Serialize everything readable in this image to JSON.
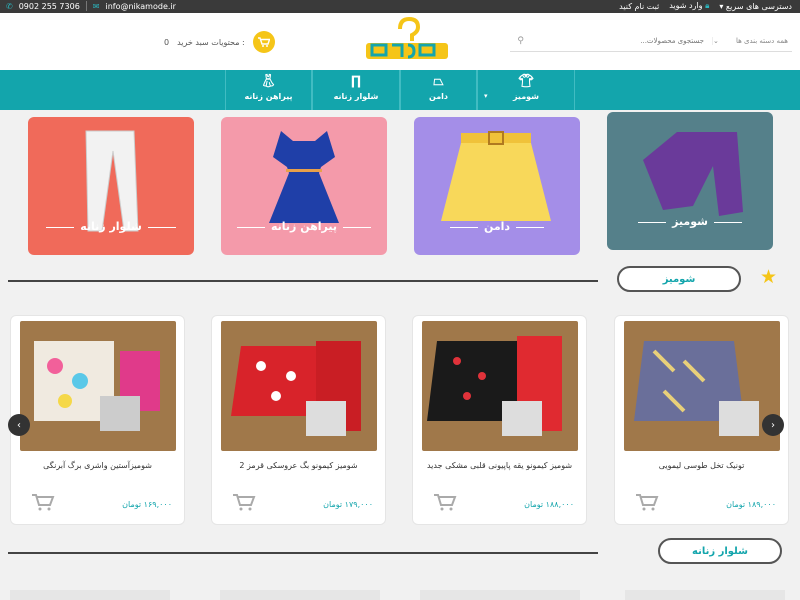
{
  "topbar": {
    "phone": "0902 255 7306",
    "email": "info@nikamode.ir",
    "quick_access": "دسترسی های سریع",
    "login": "وارد شوید",
    "register": "ثبت نام کنید"
  },
  "header": {
    "cart_label": "محتویات سبد خرید :",
    "cart_count": "0",
    "search_placeholder": "جستجوی محصولات...",
    "category_select": "همه دسته بندی ها"
  },
  "nav": [
    {
      "label": "شومیز"
    },
    {
      "label": "دامن"
    },
    {
      "label": "شلوار زنانه"
    },
    {
      "label": "پیراهن زنانه"
    }
  ],
  "category_cards": [
    {
      "label": "شلوار زنانه",
      "bg": "#f06a5a"
    },
    {
      "label": "پیراهن زنانه",
      "bg": "#f49aaa"
    },
    {
      "label": "دامن",
      "bg": "#a48ee8"
    },
    {
      "label": "شومیز",
      "bg": "#55808a"
    }
  ],
  "section1": {
    "title": "شومیز"
  },
  "products": [
    {
      "name": "شومیزآستین واشری برگ آبرنگی",
      "price": "۱۶۹,۰۰۰ تومان"
    },
    {
      "name": "شومیز کیمونو بگ عروسکی قرمز 2",
      "price": "۱۷۹,۰۰۰ تومان"
    },
    {
      "name": "شومیز کیمونو یقه پاپیونی قلبی مشکی جدید",
      "price": "۱۸۸,۰۰۰ تومان"
    },
    {
      "name": "تونیک تخل طوسی لیمویی",
      "price": "۱۸۹,۰۰۰ تومان"
    }
  ],
  "section2": {
    "title": "شلوار زنانه"
  },
  "colors": {
    "accent": "#13a5ac",
    "yellow": "#f5c518",
    "topbar": "#3a3a3a"
  }
}
